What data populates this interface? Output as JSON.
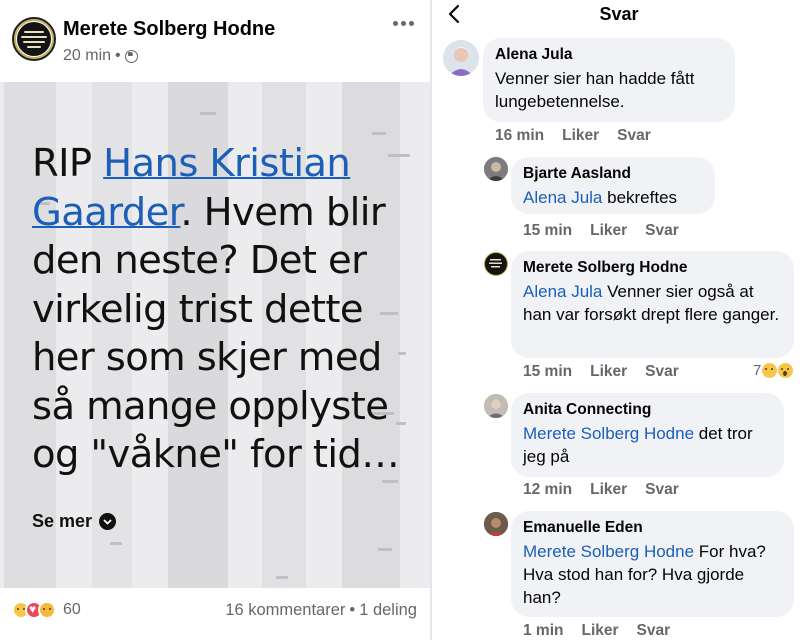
{
  "post": {
    "author": "Merete Solberg Hodne",
    "time": "20 min",
    "meta_separator": "•",
    "text_before": "RIP ",
    "mention": "Hans Kristian Gaarder",
    "text_after": ". Hvem blir den neste? Det er virkelig trist dette her som skjer med så mange opplyste og \"våkne\" for tid…",
    "see_more": "Se mer",
    "reaction_count": "60",
    "comments": "16 kommentarer",
    "separator": "•",
    "shares": "1 deling"
  },
  "replies_view": {
    "title": "Svar",
    "comments": [
      {
        "author": "Alena Jula",
        "tag": "",
        "text": "Venner sier han hadde fått lungebetennelse.",
        "time": "16 min",
        "like": "Liker",
        "reply": "Svar"
      },
      {
        "author": "Bjarte Aasland",
        "tag": "Alena Jula",
        "text": " bekreftes",
        "time": "15 min",
        "like": "Liker",
        "reply": "Svar"
      },
      {
        "author": "Merete Solberg Hodne",
        "tag": "Alena Jula",
        "text": " Venner sier også at han var forsøkt drept flere ganger.",
        "time": "15 min",
        "like": "Liker",
        "reply": "Svar",
        "reaction_count": "7"
      },
      {
        "author": "Anita Connecting",
        "tag": "Merete Solberg Hodne",
        "text": " det tror jeg på",
        "time": "12 min",
        "like": "Liker",
        "reply": "Svar"
      },
      {
        "author": "Emanuelle Eden",
        "tag": "Merete Solberg Hodne",
        "text": " For hva? Hva stod han for? Hva gjorde han?",
        "time": "1 min",
        "like": "Liker",
        "reply": "Svar"
      }
    ]
  },
  "colors": {
    "link_blue": "#1b5fb8",
    "bubble_bg": "#f0f2f5",
    "meta_gray": "#65676b",
    "post_bg": "#ececee"
  },
  "icons": [
    "globe-icon",
    "more-options-icon",
    "back-arrow-icon",
    "chevron-down-icon",
    "sad-reaction-icon",
    "love-reaction-icon",
    "care-reaction-icon",
    "wow-reaction-icon"
  ]
}
